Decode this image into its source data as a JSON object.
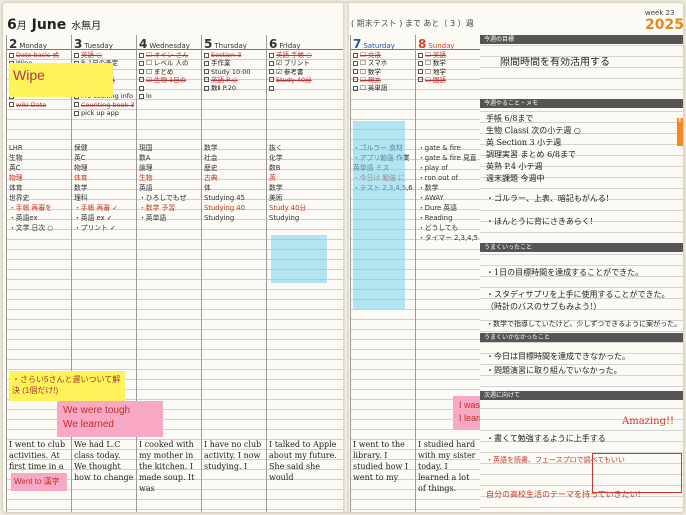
{
  "header": {
    "month": "6",
    "month_suffix": "月",
    "month_en": "June",
    "moon_label": "水無月",
    "exam_label": "期末テスト",
    "until_label": "まで あと（",
    "days_left": "3",
    "weeks_suffix": "）週",
    "week_label": "week 23",
    "year": "2025"
  },
  "days": [
    {
      "num": "2",
      "name": "Monday",
      "todos": [
        "Date basic 式",
        "Wipe",
        "",
        "",
        "",
        "",
        "wiki Date"
      ],
      "body": [
        "LHR",
        "生物",
        "英C",
        "物理",
        "体育",
        "世界史",
        "",
        "・手帳 再審を",
        "・英語ex",
        "・文学 日次 ○"
      ],
      "english": "I went to club activities. At first time in a"
    },
    {
      "num": "3",
      "name": "Tuesday",
      "todos": [
        "英語 ○",
        "P. 1日の予定",
        "宿 ラジオ",
        "☑ 音の英語",
        "☐ 古典 SS",
        "Pro cooking info",
        "Counting book 3 ☑",
        "pick up app"
      ],
      "body": [
        "保健",
        "英C",
        "物理",
        "体育",
        "数学",
        "理科",
        "",
        "・手帳 再審 ✓",
        "・英語 ex ✓",
        "・プリント ✓"
      ],
      "english": "We had L.C class today. We thought how to change"
    },
    {
      "num": "4",
      "name": "Wednesday",
      "todos": [
        "☐ オイン さん",
        "☐ レベル 人の",
        "☐ まとめ",
        "☑ 生物 1日の",
        "",
        "lo"
      ],
      "body": [
        "現国",
        "数A",
        "論理",
        "生物",
        "英語",
        "",
        "・ひろしでもぜ",
        "・数学 予習",
        "・英単語"
      ],
      "english": "I cooked with my mother in the kitchen. I made soup. It was"
    },
    {
      "num": "5",
      "name": "Thursday",
      "todos": [
        "Section 3",
        "手作業",
        "Study 10:00",
        "英語 P ○",
        "数Ⅱ P.20"
      ],
      "body": [
        "数学",
        "社会",
        "歴史",
        "古典",
        "体",
        "",
        "Studying 45",
        "Studying 40",
        "Studying"
      ],
      "english": "I have no club activity. I now studying. I"
    },
    {
      "num": "6",
      "name": "Friday",
      "todos": [
        "英語 手帳 ○",
        "☑ プリント",
        "☑ 参考書",
        "Study 40分",
        ""
      ],
      "body": [
        "抜く",
        "化学",
        "数B",
        "英",
        "数学",
        "美術",
        "",
        "Study 40分",
        "Studying"
      ],
      "english": "I talked to Apple about my future. She said she would"
    },
    {
      "num": "7",
      "name": "Saturday",
      "todos": [
        "☐ 文法",
        "☐ スマホ",
        "☐ 数学",
        "☐ 現文",
        "☐ 英単語"
      ],
      "body": [
        "・ゴルラー 食材",
        "",
        "・アプリ勉強 作業",
        "",
        "",
        "英単語 ミス",
        "",
        "・今日は 勉強 に",
        "・テスト 2,3,4,5,6"
      ],
      "english": "I went to the library. I studied how I went to my"
    },
    {
      "num": "8",
      "name": "Sunday",
      "todos": [
        "☐ 英語",
        "☐ 数学",
        "☐ 地学",
        "☐ 国語"
      ],
      "body": [
        "・gate & fire",
        "・gate & fire 見直し",
        "・play of",
        "",
        "・ron out of",
        "・数学",
        "・AWAY",
        "",
        "・Dure 英語",
        "・Reading",
        "・どうしても",
        "",
        "・タイマー 2,3,4,5,6"
      ],
      "english": "I studied hard with my sister today. I learned a lot of things."
    }
  ],
  "right_panel": {
    "section1": "今週の目標",
    "goal": "隙間時間を有効活用する",
    "section2": "今週やること・メモ",
    "tasks": [
      "手帳 6/8まで",
      "生物 Classi 次の小テ週 ○",
      "英 Section 3 小テ週",
      "調理実習 まとめ 6/8まで",
      "英熟 P.4 小テ週",
      "週末課題 今週中"
    ],
    "memo1": "・ゴルラー、上表、暗記もがんる!",
    "memo2": "・ほんとうに背にさきあらく!",
    "section3": "うまくいったこと",
    "good1": "・1日の目標時間を達成することができた。",
    "good2": "・スタディサプリを上手に使用することができた。",
    "good3": "（時計のバスのサブもみよう!）",
    "good4": "・数学で指導していたけど、少しずつできるように案がった。",
    "section4": "うまくいかなかったこと",
    "bad1": "・今日は目標時間を達成できなかった。",
    "bad2": "・問題演習に取り組んでいなかった。",
    "section5": "次週に向けて",
    "next1": "・書くて勉強するように上手する",
    "next2": "・英語を読書、フェースプロで調べてもいい",
    "next3": "自分の高校生活のテーマを持っていきたい!"
  },
  "stickies": {
    "wipe": "Wipe",
    "note_yellow": "・さらい5さんと遅いついて解決 (1個だけ!)",
    "we_were_tough": "We were tough",
    "we_learned": "We learned",
    "went_to": "Went to 漢字",
    "i_was_tough": "I was tough",
    "i_learned": "I learned a lot!",
    "amazing": "Amazing!!"
  },
  "accent_colors": {
    "orange": "#e08a1e",
    "sunday_red": "#d2481f",
    "saturday_blue": "#1d56b0",
    "yellow_note": "#fff35a",
    "pink_note": "#f7a8c5"
  }
}
